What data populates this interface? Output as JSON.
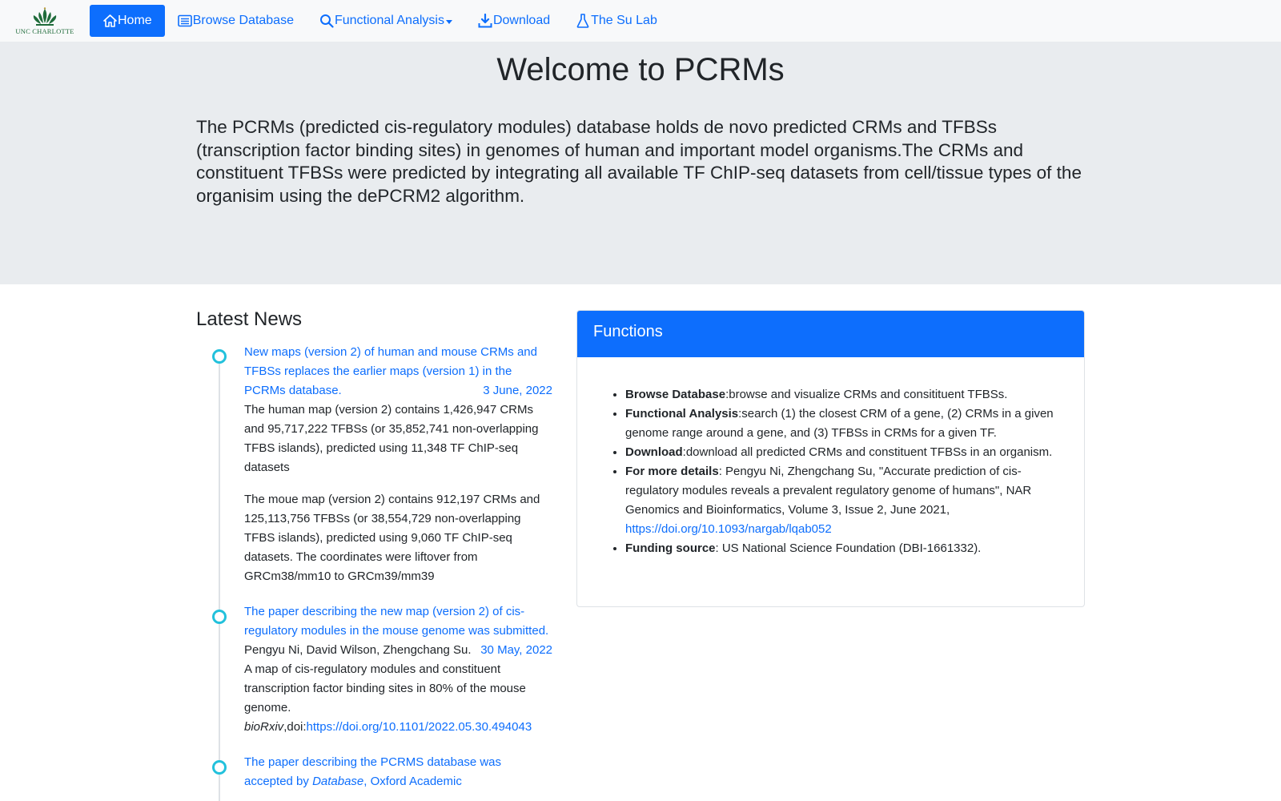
{
  "nav": {
    "logo_text": "UNC CHARLOTTE",
    "items": [
      {
        "label": "Home",
        "icon": "home-icon",
        "active": true
      },
      {
        "label": "Browse Database",
        "icon": "table-list-icon"
      },
      {
        "label": "Functional Analysis",
        "icon": "search-icon",
        "dropdown": true
      },
      {
        "label": "Download",
        "icon": "download-icon"
      },
      {
        "label": "The Su Lab",
        "icon": "flask-icon"
      }
    ]
  },
  "jumbotron": {
    "title": "Welcome to PCRMs",
    "lead": "The PCRMs (predicted cis-regulatory modules) database holds de novo predicted CRMs and TFBSs (transcription factor binding sites) in genomes of human and important model organisms.The CRMs and constituent TFBSs were predicted by integrating all available TF ChIP-seq datasets from cell/tissue types of the organisim using the dePCRM2 algorithm."
  },
  "news": {
    "title": "Latest News",
    "items": [
      {
        "headline": "New maps (version 2) of human and mouse CRMs and TFBSs replaces the earlier maps (version 1) in the PCRMs database.",
        "date": "3 June, 2022",
        "body1": "The human map (version 2) contains 1,426,947 CRMs and 95,717,222 TFBSs (or 35,852,741 non-overlapping TFBS islands), predicted using 11,348 TF ChIP-seq datasets",
        "body2": "The moue map (version 2) contains 912,197 CRMs and 125,113,756 TFBSs (or 38,554,729 non-overlapping TFBS islands), predicted using 9,060 TF ChIP-seq datasets. The coordinates were liftover from GRCm38/mm10 to GRCm39/mm39"
      },
      {
        "headline": "The paper describing the new map (version 2) of cis-regulatory modules in the mouse genome was submitted.",
        "date": "30 May, 2022",
        "body1": "Pengyu Ni, David Wilson, Zhengchang Su. A map of cis-regulatory modules and constituent transcription factor binding sites in 80% of the mouse genome.",
        "journal": "bioRxiv",
        "doi_prefix": ",doi:",
        "doi_link": "https://doi.org/10.1101/2022.05.30.494043"
      },
      {
        "headline_a": "The paper describing the PCRMS database was accepted by ",
        "headline_em": "Database",
        "headline_b": ", Oxford Academic"
      }
    ]
  },
  "functions": {
    "title": "Functions",
    "items": [
      {
        "term": "Browse Database",
        "text": ":browse and visualize CRMs and consitituent TFBSs."
      },
      {
        "term": "Functional Analysis",
        "text": ":search (1) the closest CRM of a gene, (2) CRMs in a given genome range around a gene, and (3) TFBSs in CRMs for a given TF."
      },
      {
        "term": "Download",
        "text": ":download all predicted CRMs and constituent TFBSs in an organism."
      },
      {
        "term": "For more details",
        "text": ": Pengyu Ni, Zhengchang Su, \"Accurate prediction of cis-regulatory modules reveals a prevalent regulatory genome of humans\", NAR Genomics and Bioinformatics, Volume 3, Issue 2, June 2021,",
        "link": "https://doi.org/10.1093/nargab/lqab052"
      },
      {
        "term": "Funding source",
        "text": ": US National Science Foundation (DBI-1661332)."
      }
    ]
  },
  "colors": {
    "primary": "#0d6efd",
    "navbar_bg": "#f8f9fa",
    "jumbotron_bg": "#e9ecef",
    "timeline_dot": "#22c1dc",
    "logo_green": "#1f6b3a"
  }
}
